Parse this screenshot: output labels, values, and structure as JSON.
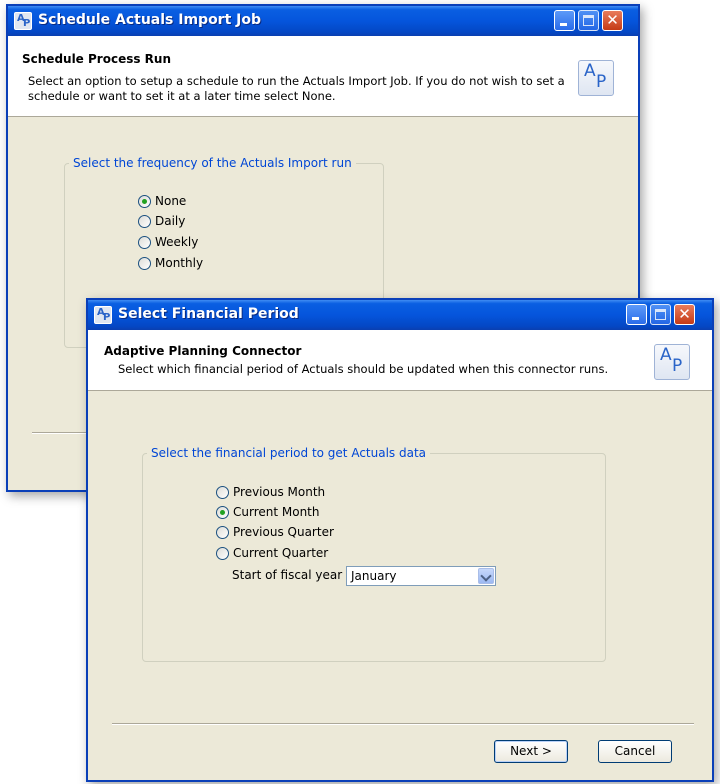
{
  "back_window": {
    "title": "Schedule Actuals Import Job",
    "header": {
      "title": "Schedule Process Run",
      "description": "Select an option to setup a schedule to run the Actuals Import Job. If you do not wish to set a schedule or want to set it at a later time select None."
    },
    "group_label": "Select the frequency of the Actuals Import run",
    "options": [
      {
        "label": "None",
        "checked": true
      },
      {
        "label": "Daily",
        "checked": false
      },
      {
        "label": "Weekly",
        "checked": false
      },
      {
        "label": "Monthly",
        "checked": false
      }
    ]
  },
  "front_window": {
    "title": "Select Financial Period",
    "header": {
      "title": "Adaptive Planning Connector",
      "description": "Select which financial period of Actuals should be updated when this connector runs."
    },
    "group_label": "Select the financial period to get Actuals data",
    "options": [
      {
        "label": "Previous Month",
        "checked": false
      },
      {
        "label": "Current Month",
        "checked": true
      },
      {
        "label": "Previous Quarter",
        "checked": false
      },
      {
        "label": "Current Quarter",
        "checked": false
      }
    ],
    "fiscal_label": "Start of fiscal year",
    "fiscal_value": "January",
    "buttons": {
      "next": "Next >",
      "cancel": "Cancel"
    }
  },
  "icons": {
    "app_icon": "adaptive-planning-icon",
    "logo": "adaptive-planning-logo",
    "close": "close-icon",
    "minimize": "minimize-icon",
    "maximize": "maximize-icon",
    "dropdown": "chevron-down-icon"
  },
  "logo_text": {
    "a": "A",
    "p": "P"
  },
  "colors": {
    "titlebar": "#0555dc",
    "group_label": "#0046d5",
    "radio_dot": "#21a121",
    "window_bg": "#ece9d8"
  }
}
